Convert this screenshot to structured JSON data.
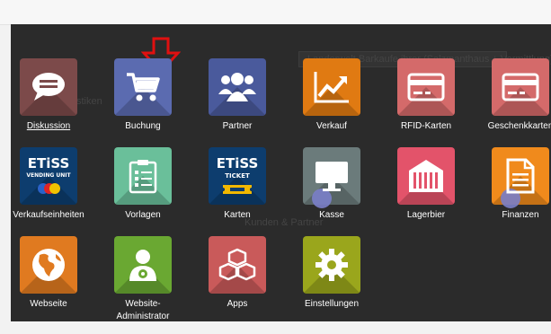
{
  "background": {
    "ghost_text": [
      "Landerwelt Barkaufe ihrer (Salzmanthaus + Vermittlung)",
      "Verkaufsstatistiken",
      "Kunden & Partner"
    ]
  },
  "apps": [
    {
      "label": "Diskussion",
      "color": "#7c4a4a",
      "icon": "chat-bubble-icon",
      "underline": true
    },
    {
      "label": "Buchung",
      "color": "#5b6bb0",
      "icon": "shopping-cart-icon"
    },
    {
      "label": "Partner",
      "color": "#4a5a9c",
      "icon": "people-group-icon"
    },
    {
      "label": "Verkauf",
      "color": "#e07a12",
      "icon": "trend-chart-icon"
    },
    {
      "label": "RFID-Karten",
      "color": "#d46a6a",
      "icon": "credit-card-icon"
    },
    {
      "label": "Geschenkkarten",
      "color": "#d46a6a",
      "icon": "credit-card-icon"
    },
    {
      "label": "Verkaufseinheiten",
      "color": "#0d3d6e",
      "icon": "etiss-vending-logo",
      "logo_title": "ETiSS",
      "logo_sub": "VENDING UNIT"
    },
    {
      "label": "Vorlagen",
      "color": "#6abf9a",
      "icon": "clipboard-list-icon"
    },
    {
      "label": "Karten",
      "color": "#0d3d6e",
      "icon": "etiss-ticket-logo",
      "logo_title": "ETiSS",
      "logo_sub": "TICKET"
    },
    {
      "label": "Kasse",
      "color": "#6b7b7b",
      "icon": "monitor-icon"
    },
    {
      "label": "Lagerbier",
      "color": "#e3536a",
      "icon": "warehouse-icon"
    },
    {
      "label": "Finanzen",
      "color": "#f08a1c",
      "icon": "document-icon"
    },
    {
      "label": "Webseite",
      "color": "#e07a20",
      "icon": "globe-icon"
    },
    {
      "label": "Website-\nAdministrator",
      "color": "#6aa832",
      "icon": "admin-user-icon"
    },
    {
      "label": "Apps",
      "color": "#c95a5a",
      "icon": "cubes-icon"
    },
    {
      "label": "Einstellungen",
      "color": "#9aa61c",
      "icon": "gear-icon"
    }
  ],
  "colors": {
    "overlay": "#2b2b2b",
    "arrow": "#e01010",
    "cursor_dot": "#7b7fc9"
  }
}
